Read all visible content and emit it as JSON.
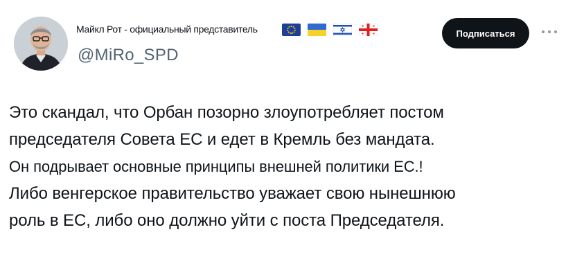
{
  "author": {
    "display_name": "Майкл Рот - официальный представитель",
    "handle": "@MiRo_SPD",
    "flags": [
      "eu-flag-icon",
      "ukraine-flag-icon",
      "israel-flag-icon",
      "georgia-flag-icon"
    ]
  },
  "actions": {
    "subscribe_label": "Подписаться",
    "more_icon": "more-dots-icon"
  },
  "tweet": {
    "lines": [
      "Это скандал, что Орбан позорно злоупотребляет постом",
      "председателя Совета ЕС и едет в Кремль без мандата.",
      "Он подрывает основные принципы внешней политики ЕС.!",
      "Либо венгерское правительство уважает свою нынешнюю",
      "роль в ЕС, либо оно должно уйти с поста Председателя."
    ]
  },
  "colors": {
    "text": "#0f1419",
    "secondary": "#536471",
    "button_bg": "#0f1419",
    "button_text": "#ffffff"
  }
}
